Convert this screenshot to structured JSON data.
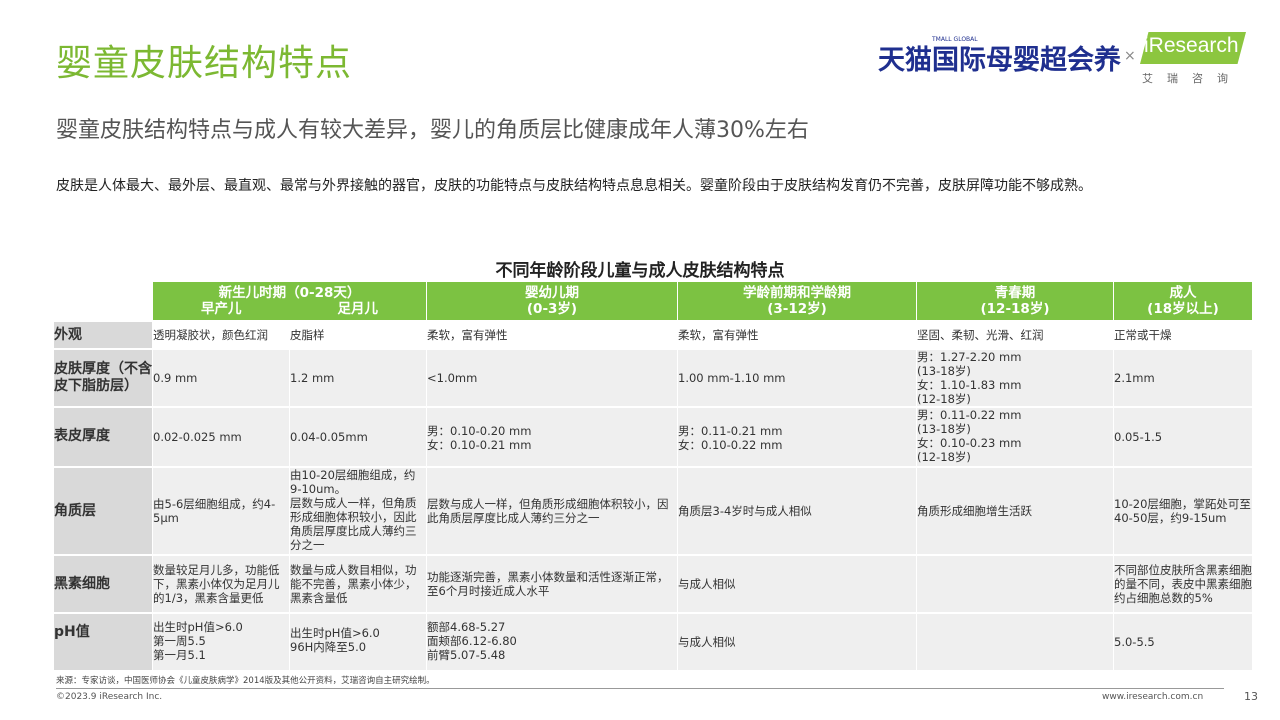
{
  "header": {
    "title": "婴童皮肤结构特点",
    "subtitle": "婴童皮肤结构特点与成人有较大差异，婴儿的角质层比健康成年人薄30%左右",
    "intro": "皮肤是人体最大、最外层、最直观、最常与外界接触的器官，皮肤的功能特点与皮肤结构特点息息相关。婴童阶段由于皮肤结构发育仍不完善，皮肤屏障功能不够成熟。"
  },
  "logos": {
    "tmall_small": "TMALL GLOBAL",
    "tmall": "天猫国际母婴超会养",
    "separator": "×",
    "iresearch": "iResearch",
    "iresearch_cn": "艾瑞咨询"
  },
  "table": {
    "title": "不同年龄阶段儿童与成人皮肤结构特点",
    "headers": {
      "newborn_top": "新生儿时期（0-28天）",
      "preterm": "早产儿",
      "fullterm": "足月儿",
      "infant": "婴幼儿期",
      "infant_range": "(0-3岁)",
      "school": "学龄前期和学龄期",
      "school_range": "(3-12岁)",
      "teen": "青春期",
      "teen_range": "(12-18岁)",
      "adult": "成人",
      "adult_range": "(18岁以上)"
    },
    "rows": [
      {
        "label": "外观",
        "cells": [
          "透明凝胶状，颜色红润",
          "皮脂样",
          "柔软，富有弹性",
          "柔软，富有弹性",
          "坚固、柔韧、光滑、红润",
          "正常或干燥"
        ]
      },
      {
        "label": "皮肤厚度（不含皮下脂肪层）",
        "cells": [
          "0.9 mm",
          "1.2 mm",
          "<1.0mm",
          "1.00 mm-1.10 mm",
          "男：1.27-2.20 mm\n(13-18岁)\n女：1.10-1.83 mm\n  (12-18岁)",
          "2.1mm"
        ]
      },
      {
        "label": "表皮厚度",
        "cells": [
          "0.02-0.025 mm",
          "0.04-0.05mm",
          "男：0.10-0.20 mm\n女：0.10-0.21 mm",
          "男：0.11-0.21 mm\n女：0.10-0.22 mm",
          "男：0.11-0.22 mm\n  (13-18岁)\n女：0.10-0.23 mm\n  (12-18岁)",
          "0.05-1.5"
        ]
      },
      {
        "label": "角质层",
        "cells": [
          "由5-6层细胞组成，约4-5μm",
          "由10-20层细胞组成，约9-10um。\n层数与成人一样，但角质形成细胞体积较小，因此角质层厚度比成人薄约三分之一",
          "层数与成人一样，但角质形成细胞体积较小，因此角质层厚度比成人薄约三分之一",
          "角质层3-4岁时与成人相似",
          "角质形成细胞增生活跃",
          "10-20层细胞，掌跖处可至40-50层，约9-15um"
        ]
      },
      {
        "label": "黑素细胞",
        "cells": [
          "数量较足月儿多，功能低下，黑素小体仅为足月儿的1/3，黑素含量更低",
          "数量与成人数目相似，功能不完善，黑素小体少，黑素含量低",
          "功能逐渐完善，黑素小体数量和活性逐渐正常，至6个月时接近成人水平",
          "与成人相似",
          "",
          "不同部位皮肤所含黑素细胞的量不同，表皮中黑素细胞约占细胞总数的5%"
        ]
      },
      {
        "label": "pH值",
        "cells": [
          "出生时pH值>6.0\n第一周5.5\n第一月5.1",
          "出生时pH值>6.0\n96H内降至5.0",
          "额部4.68-5.27\n面颊部6.12-6.80\n前臂5.07-5.48",
          "与成人相似",
          "",
          "5.0-5.5"
        ]
      }
    ]
  },
  "footer": {
    "source": "来源：专家访谈，中国医师协会《儿童皮肤病学》2014版及其他公开资料，艾瑞咨询自主研究绘制。",
    "copyright": "©2023.9 iResearch Inc.",
    "website": "www.iresearch.com.cn",
    "page": "13"
  }
}
